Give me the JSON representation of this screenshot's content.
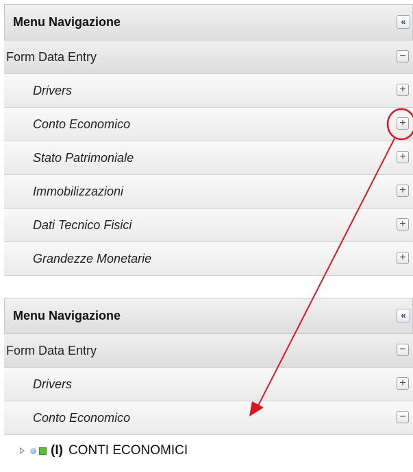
{
  "panels": [
    {
      "header": {
        "title": "Menu Navigazione",
        "collapse_icon": "«"
      },
      "group": {
        "label": "Form Data Entry",
        "toggle": "−"
      },
      "items": [
        {
          "label": "Drivers",
          "toggle": "+"
        },
        {
          "label": "Conto Economico",
          "toggle": "+"
        },
        {
          "label": "Stato Patrimoniale",
          "toggle": "+"
        },
        {
          "label": "Immobilizzazioni",
          "toggle": "+"
        },
        {
          "label": "Dati Tecnico Fisici",
          "toggle": "+"
        },
        {
          "label": "Grandezze Monetarie",
          "toggle": "+"
        }
      ]
    },
    {
      "header": {
        "title": "Menu Navigazione",
        "collapse_icon": "«"
      },
      "group": {
        "label": "Form Data Entry",
        "toggle": "−"
      },
      "items": [
        {
          "label": "Drivers",
          "toggle": "+"
        },
        {
          "label": "Conto Economico",
          "toggle": "−"
        }
      ]
    }
  ],
  "tree": {
    "node_prefix": "(I)",
    "node_label": "CONTI ECONOMICI"
  },
  "annotation": {
    "color": "#e0141e"
  }
}
